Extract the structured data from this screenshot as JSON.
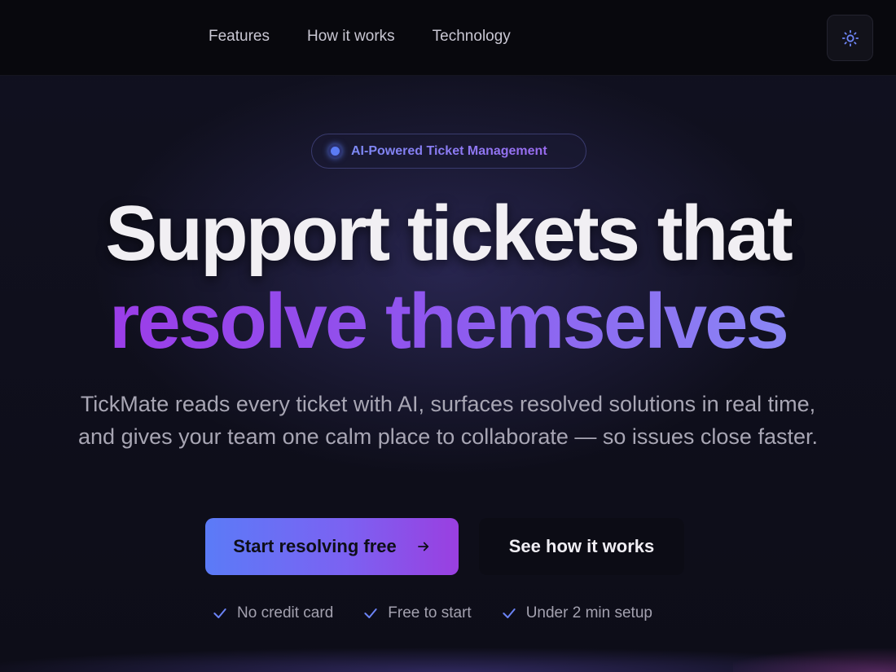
{
  "nav": {
    "items": [
      {
        "label": "Features"
      },
      {
        "label": "How it works"
      },
      {
        "label": "Technology"
      }
    ],
    "theme_toggle_icon": "sun-icon"
  },
  "hero": {
    "badge": "AI-Powered Ticket Management",
    "headline_line1": "Support tickets that",
    "headline_line2": "resolve themselves",
    "subtitle": "TickMate reads every ticket with AI, surfaces resolved solutions in real time, and gives your team one calm place to collaborate — so issues close faster.",
    "primary_cta": "Start resolving free",
    "secondary_cta": "See how it works",
    "checks": [
      {
        "label": "No credit card"
      },
      {
        "label": "Free to start"
      },
      {
        "label": "Under 2 min setup"
      }
    ]
  },
  "colors": {
    "accent_blue": "#5b7cf5",
    "accent_purple": "#9b3de8",
    "background": "#0c0c14"
  }
}
